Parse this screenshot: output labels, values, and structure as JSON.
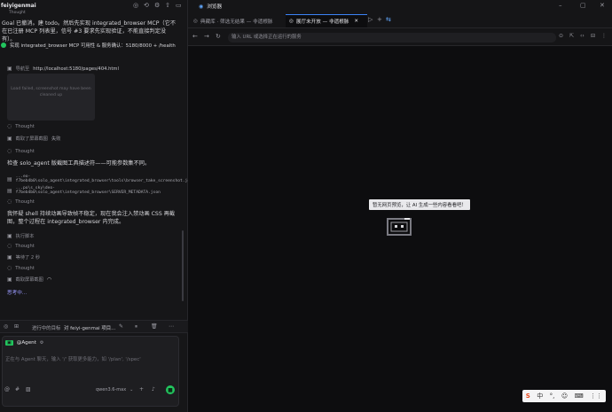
{
  "left": {
    "workspace_title": "feiyigenmai",
    "header_partial": "Thought",
    "goal_text": "Goal 已撤消。建 todo。然后先实现 integrated_browser MCP（它不在已注册 MCP 列表里，信号 #3 要求先实现验证，不能直接判定没有）。",
    "verify_item": "实现 integrated_browser MCP 可用性 & 服务确认：5180/8000 + /health",
    "nav_to_label": "导航至",
    "nav_url": "http://localhost:5180/pages/404.html",
    "screenshot_failed": "Load failed, screenshot may have been cleaned up",
    "thought_1": "Thought",
    "shot_label": "截取了屏幕截图",
    "shot_status": "失败",
    "thought_2": "Thought",
    "check_text": "检查 solo_agent 版截图工具描述符——可能参数集不同。",
    "path_1": "...eo-f7beb4b0\\solo_agent\\integrated_browser\\tools\\browser_take_screenshot.json",
    "path_2": "...po\\s_sky\\deo-f7beb4b0\\solo_agent\\integrated_browser\\SERVER_METADATA.json",
    "thought_3": "Thought",
    "suspect_text": "我怀疑 shell 持续动画导致帧不稳定，现在我会注入禁动画 CSS 再截图，整个过程在 integrated_browser 内完成。",
    "run_script": "执行脚本",
    "thought_4": "Thought",
    "wait_label": "等待了 2 秒",
    "thought_5": "Thought",
    "taking_shot": "截取屏幕截图",
    "thinking": "思考中...",
    "task_status": "进行中的目标",
    "task_text": "对 feiyi-genmai 项目...",
    "agent_label": "@Agent",
    "input_placeholder": "正在与 Agent 聊天，输入 '/' 获取更多能力，如 '/plan', '/spec'",
    "model_name": "qwen3.6-max"
  },
  "right": {
    "window_title": "浏览器",
    "tabs": [
      {
        "label": "典藏库 · 筛选无结果 — 非遗根脉"
      },
      {
        "label": "展厅未开放 — 非遗根脉"
      }
    ],
    "url_placeholder": "输入 URL 或选择正在运行的服务",
    "empty_tooltip": "暂无网页预览，让 AI 生成一些内容看看吧！"
  },
  "ime": {
    "logo": "S",
    "items": [
      "中",
      "°,",
      "☺",
      "⌨",
      "⋮⋮"
    ]
  },
  "colors": {
    "accent": "#22c55e",
    "tab_active": "#3b82f6"
  }
}
